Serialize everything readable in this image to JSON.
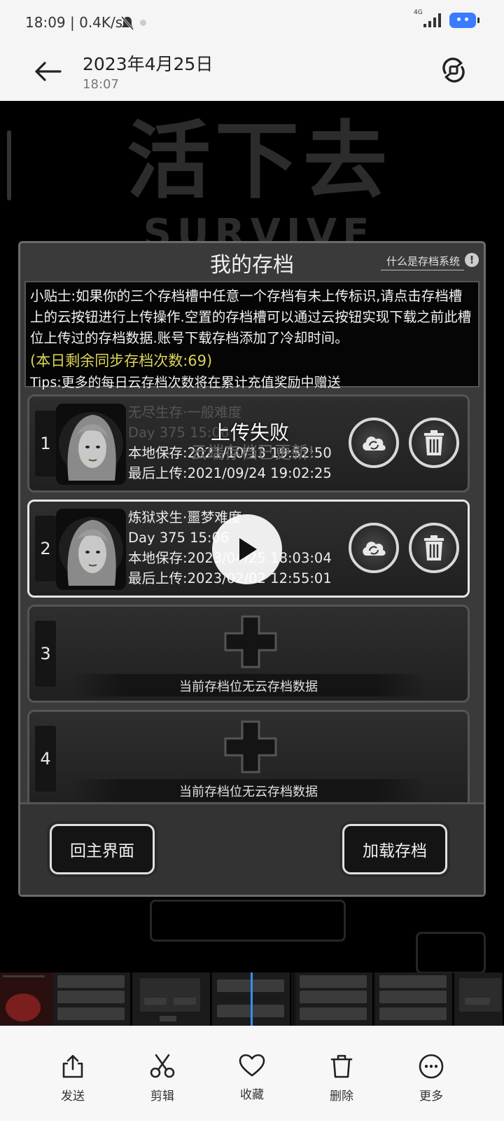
{
  "status_bar": {
    "time_speed": "18:09 | 0.4K/s",
    "network": "4G"
  },
  "header": {
    "date": "2023年4月25日",
    "time": "18:07",
    "back_icon": "back-arrow-icon",
    "rotate_icon": "rotate-icon"
  },
  "game": {
    "bg_title": "活下去",
    "bg_title_en": "SURVIVE",
    "dialog": {
      "title": "我的存档",
      "help_link": "什么是存档系统",
      "tip": "小贴士:如果你的三个存档槽中任意一个存档有未上传标识,请点击存档槽上的云按钮进行上传操作.空置的存档槽可以通过云按钮实现下载之前此槽位上传过的存档数据.账号下载存档添加了冷却时间。",
      "sync_count": "(本日剩余同步存档次数:69)",
      "tips_extra": "Tips:更多的每日云存档次数将在累计充值奖励中赠送",
      "toast": "上传失败",
      "toast_ghost": "云端存档已更新!",
      "slots": [
        {
          "number": "1",
          "name": "无尽生存·一般难度",
          "day": "Day 375  15:06",
          "local_save": "本地保存:2021/10/13  19:52:50",
          "last_upload": "最后上传:2021/09/24  19:02:25"
        },
        {
          "number": "2",
          "name": "炼狱求生·噩梦难度",
          "day": "Day 375  15:06",
          "local_save": "本地保存:2023/04/25  18:03:04",
          "last_upload": "最后上传:2023/02/02  12:55:01"
        },
        {
          "number": "3",
          "empty_text": "当前存档位无云存档数据"
        },
        {
          "number": "4",
          "empty_text": "当前存档位无云存档数据"
        }
      ],
      "back_button": "回主界面",
      "load_button": "加载存档"
    }
  },
  "toolbar": [
    {
      "label": "发送",
      "icon": "share-icon"
    },
    {
      "label": "剪辑",
      "icon": "scissors-icon"
    },
    {
      "label": "收藏",
      "icon": "heart-icon"
    },
    {
      "label": "删除",
      "icon": "trash-icon"
    },
    {
      "label": "更多",
      "icon": "more-icon"
    }
  ],
  "colors": {
    "sync_count": "#d9d45a",
    "scrub_line": "#3c8cff",
    "battery": "#3a7bff"
  }
}
